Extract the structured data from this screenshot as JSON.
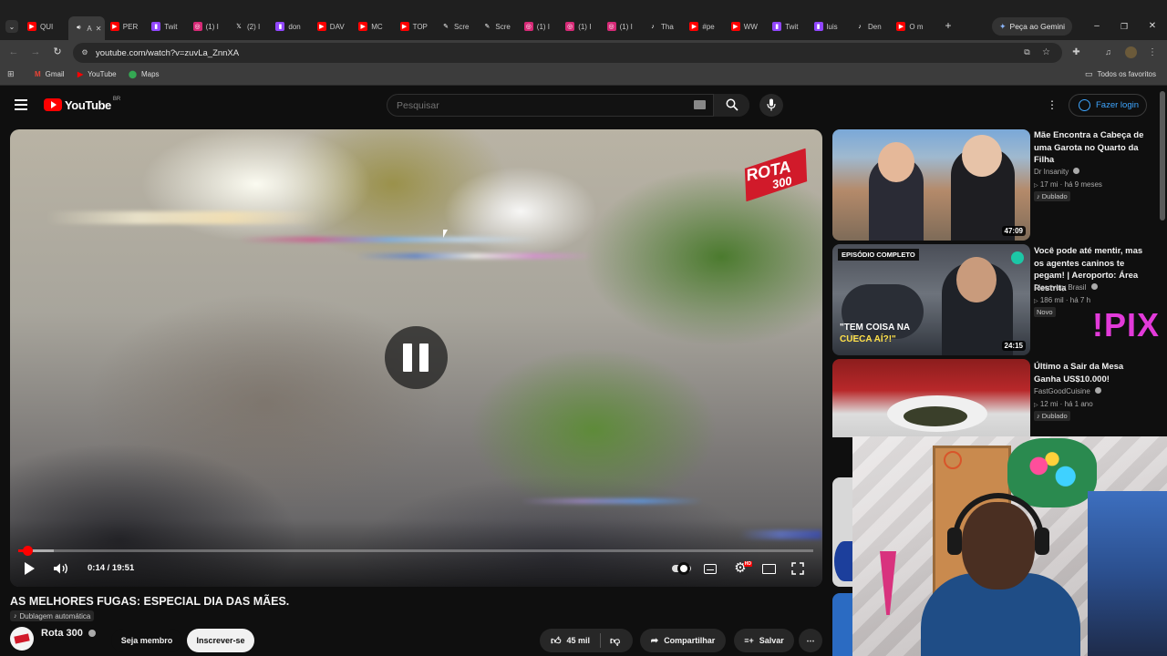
{
  "browser": {
    "tabs": [
      {
        "label": "QUI",
        "icon": "youtube-icon"
      },
      {
        "label": "A",
        "icon": "audio-icon",
        "active": true
      },
      {
        "label": "PER",
        "icon": "youtube-icon"
      },
      {
        "label": "Twit",
        "icon": "twitch-icon"
      },
      {
        "label": "(1) I",
        "icon": "instagram-icon"
      },
      {
        "label": "(2) I",
        "icon": "x-icon"
      },
      {
        "label": "don",
        "icon": "twitch-icon"
      },
      {
        "label": "DAV",
        "icon": "youtube-icon"
      },
      {
        "label": "MC",
        "icon": "youtube-icon"
      },
      {
        "label": "TOP",
        "icon": "youtube-icon"
      },
      {
        "label": "Scre",
        "icon": "pen-icon"
      },
      {
        "label": "Scre",
        "icon": "pen-icon"
      },
      {
        "label": "(1) I",
        "icon": "instagram-icon"
      },
      {
        "label": "(1) I",
        "icon": "instagram-icon"
      },
      {
        "label": "(1) I",
        "icon": "instagram-icon"
      },
      {
        "label": "Tha",
        "icon": "tiktok-icon"
      },
      {
        "label": "#pe",
        "icon": "youtube-icon"
      },
      {
        "label": "WW",
        "icon": "youtube-icon"
      },
      {
        "label": "Twit",
        "icon": "twitch-icon"
      },
      {
        "label": "luis",
        "icon": "twitch-icon"
      },
      {
        "label": "Den",
        "icon": "tiktok-icon"
      },
      {
        "label": "O m",
        "icon": "youtube-icon"
      }
    ],
    "new_tab": "+",
    "gemini_label": "Peça ao Gemini",
    "url": "youtube.com/watch?v=zuvLa_ZnnXA",
    "bookmarks": [
      {
        "label": "Gmail",
        "icon": "gmail-icon"
      },
      {
        "label": "YouTube",
        "icon": "youtube-icon"
      },
      {
        "label": "Maps",
        "icon": "maps-icon"
      }
    ],
    "all_bookmarks": "Todos os favoritos"
  },
  "youtube": {
    "logo_text": "YouTube",
    "country": "BR",
    "search_placeholder": "Pesquisar",
    "login_label": "Fazer login"
  },
  "player": {
    "watermark_line1": "ROTA",
    "watermark_line2": "300",
    "current_time": "0:14",
    "duration": "19:51",
    "time_display": "0:14 / 19:51",
    "progress_fraction": 0.0118,
    "buffer_fraction": 0.045,
    "state": "paused",
    "settings_badge": "HD"
  },
  "video": {
    "title": "AS MELHORES FUGAS: ESPECIAL DIA DAS MÃES.",
    "dubbing_label": "Dublagem automática",
    "channel_name": "Rota 300",
    "member_button": "Seja membro",
    "subscribe_button": "Inscrever-se",
    "likes": "45 mil",
    "share_label": "Compartilhar",
    "save_label": "Salvar"
  },
  "recommendations": [
    {
      "title": "Mãe Encontra a Cabeça de uma Garota no Quarto da Filha",
      "channel": "Dr Insanity",
      "verified": true,
      "views": "17 mi",
      "age": "há 9 meses",
      "badge": "Dublado",
      "duration": "47:09"
    },
    {
      "title": "Você pode até mentir, mas os agentes caninos te pegam! | Aeroporto: Área Restrita",
      "channel": "Discovery Brasil",
      "verified": true,
      "views": "186 mil",
      "age": "há 7 h",
      "badge": "Novo",
      "duration": "24:15",
      "thumb_top_label": "EPISÓDIO COMPLETO",
      "thumb_caption_1": "\"TEM COISA NA",
      "thumb_caption_2": "CUECA AÍ?!\""
    },
    {
      "title": "Último a Sair da Mesa Ganha US$10.000!",
      "channel": "FastGoodCuisine",
      "verified": true,
      "views": "12 mi",
      "age": "há 1 ano",
      "badge": "Dublado"
    }
  ],
  "overlay": {
    "pix_text": "!PIX"
  },
  "colors": {
    "yt_red": "#ff0000",
    "link_blue": "#3ea6ff",
    "pix_magenta": "#e23ad9"
  }
}
